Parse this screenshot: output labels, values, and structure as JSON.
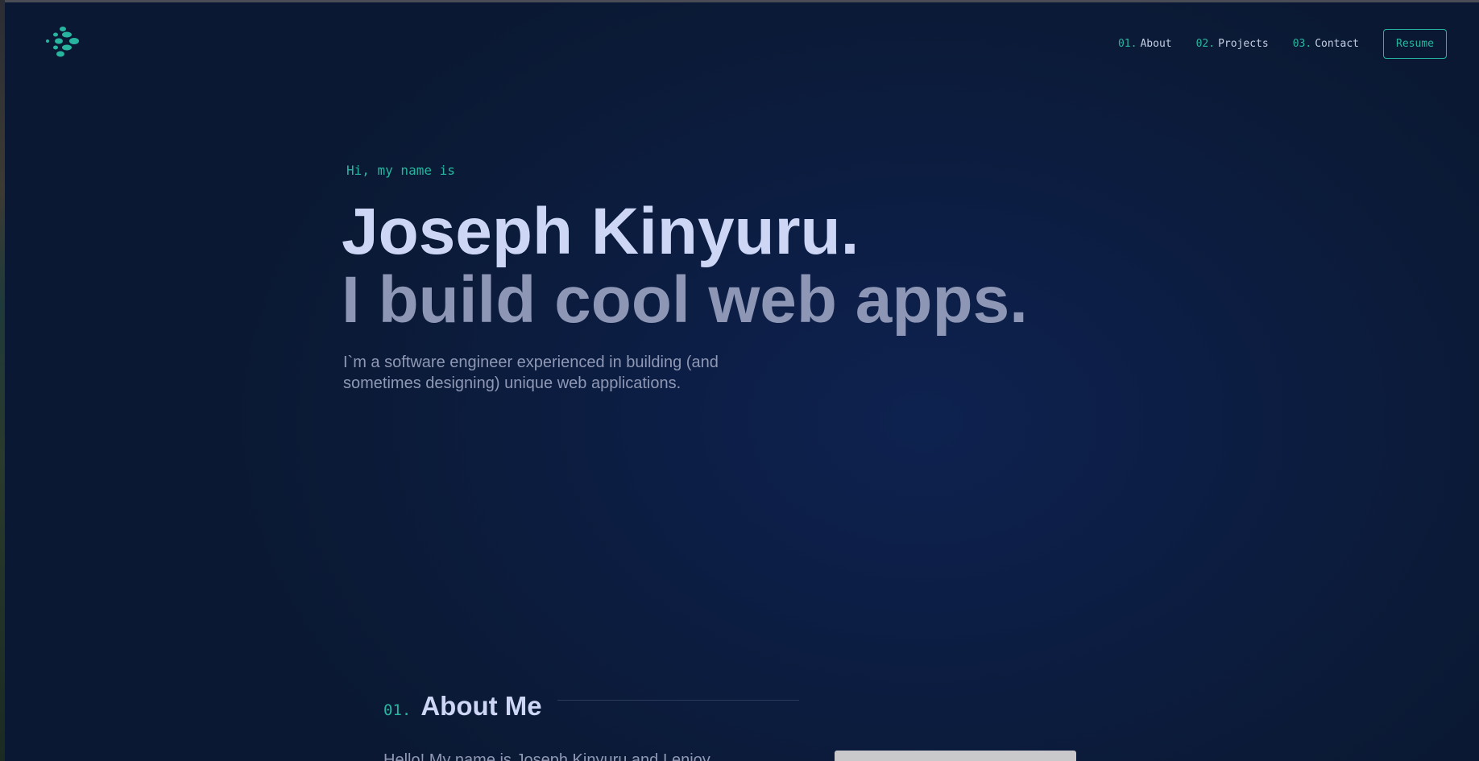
{
  "colors": {
    "accent": "#28b59f",
    "background": "#0c1a36",
    "heading": "#cdd6f4",
    "muted": "#8e96b5"
  },
  "header": {
    "logo_icon": "dotted-diamond-logo",
    "nav": [
      {
        "num": "01.",
        "label": "About"
      },
      {
        "num": "02.",
        "label": "Projects"
      },
      {
        "num": "03.",
        "label": "Contact"
      }
    ],
    "resume_label": "Resume"
  },
  "hero": {
    "greeting": "Hi, my name is",
    "name": "Joseph Kinyuru.",
    "tagline": "I build cool web apps.",
    "description": "I`m a software engineer experienced in building (and sometimes designing) unique web applications."
  },
  "about": {
    "number": "01.",
    "title": "About Me",
    "intro": "Hello! My name is Joseph Kinyuru and I enjoy"
  }
}
